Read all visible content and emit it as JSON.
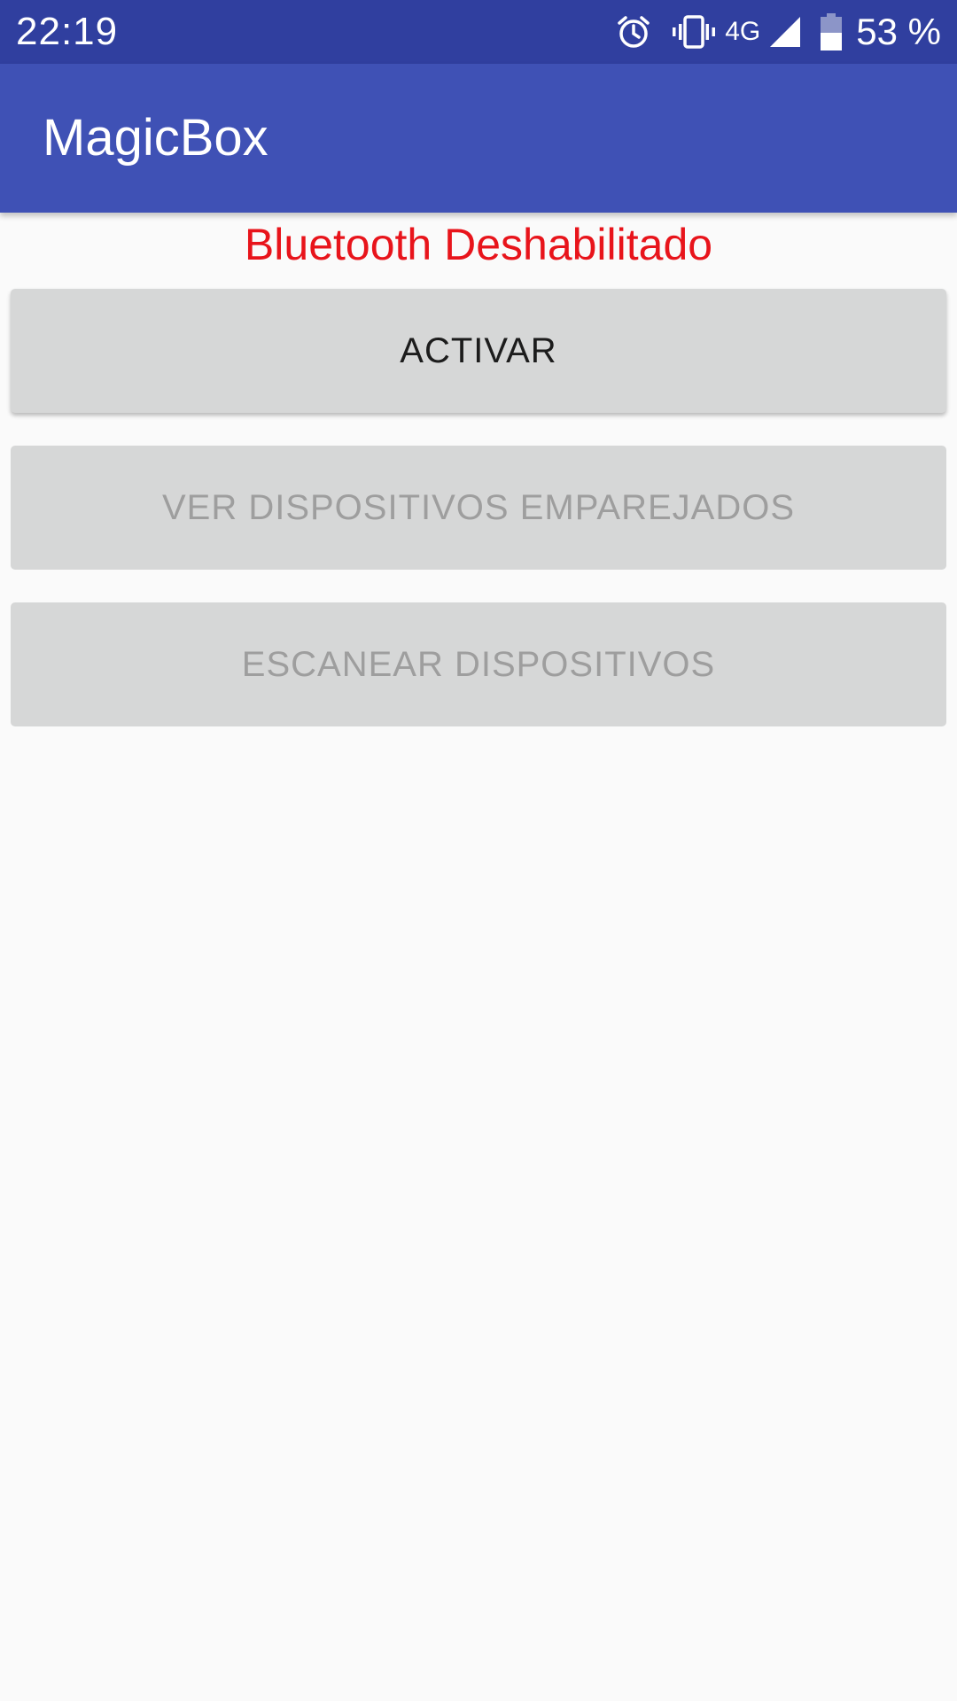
{
  "status_bar": {
    "time": "22:19",
    "network": "4G",
    "battery": "53 %",
    "icons": [
      "alarm-icon",
      "vibrate-icon",
      "signal-icon",
      "battery-icon"
    ]
  },
  "app_bar": {
    "title": "MagicBox",
    "color": "#3f51b5"
  },
  "main": {
    "bluetooth_status": "Bluetooth Deshabilitado",
    "bluetooth_status_color": "#e8141b",
    "buttons": {
      "activar": "ACTIVAR",
      "emparejados": "VER DISPOSITIVOS EMPAREJADOS",
      "escanear": "ESCANEAR DISPOSITIVOS"
    }
  }
}
